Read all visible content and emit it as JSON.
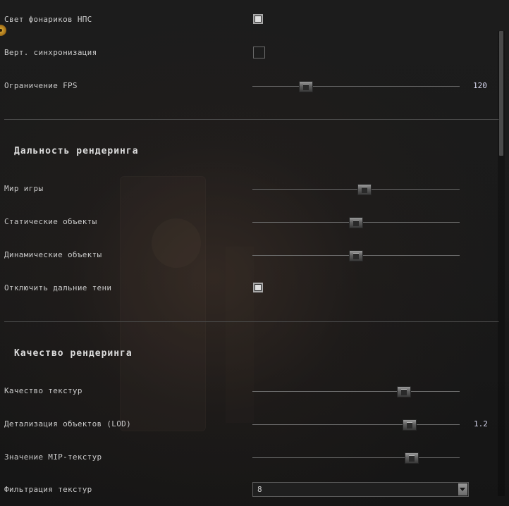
{
  "settings": {
    "npc_flashlights": {
      "label": "Свет фонариков НПС",
      "checked": true
    },
    "vsync": {
      "label": "Верт. синхронизация",
      "checked": false
    },
    "fps_limit": {
      "label": "Ограничение FPS",
      "value": "120",
      "level": 0.26
    }
  },
  "render_distance": {
    "heading": "Дальность рендеринга",
    "game_world": {
      "label": "Мир игры",
      "level": 0.54
    },
    "static_objects": {
      "label": "Статические объекты",
      "level": 0.5
    },
    "dynamic_objects": {
      "label": "Динамические объекты",
      "level": 0.5
    },
    "disable_far_shadows": {
      "label": "Отключить дальние тени",
      "checked": true
    }
  },
  "render_quality": {
    "heading": "Качество рендеринга",
    "texture_quality": {
      "label": "Качество текстур",
      "level": 0.73
    },
    "lod": {
      "label": "Детализация объектов (LOD)",
      "value": "1.2",
      "level": 0.76
    },
    "mip": {
      "label": "Значение MIP-текстур",
      "level": 0.77
    },
    "texture_filtering": {
      "label": "Фильтрация текстур",
      "value": "8"
    }
  },
  "icons": {
    "radiation": "radiation-icon",
    "select_arrow": "chevron-down-icon"
  },
  "colors": {
    "value_text": "#d6d6ee",
    "label_text": "#c9c9c9",
    "background": "#1a1a1a"
  }
}
